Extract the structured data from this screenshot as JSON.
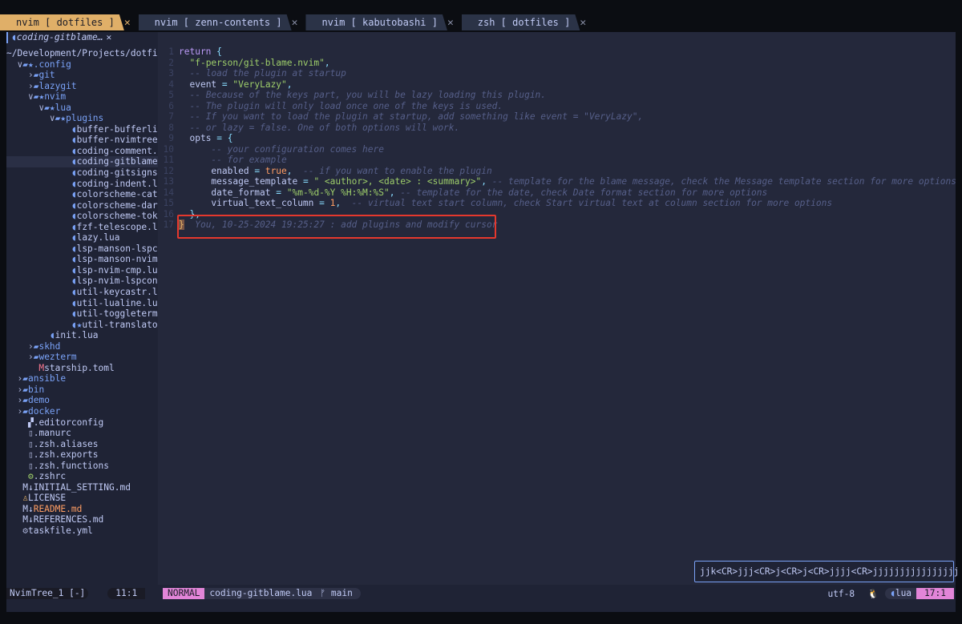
{
  "tabs": [
    {
      "label": "nvim [ dotfiles ]",
      "active": true
    },
    {
      "label": "nvim [ zenn-contents ]",
      "active": false
    },
    {
      "label": "nvim [ kabutobashi ]",
      "active": false
    },
    {
      "label": "zsh [ dotfiles ]",
      "active": false
    }
  ],
  "tab_close_glyph": "✕",
  "sidebar": {
    "header_file": "coding-gitblame…",
    "header_close": "✕",
    "root_path": "~/Development/Projects/dotfi",
    "rows": [
      {
        "indent": "  ",
        "arrow": "∨",
        "icon": "▰★",
        "label": ".config",
        "icolor": "c-blue",
        "lcolor": "c-blue"
      },
      {
        "indent": "    ",
        "arrow": "›",
        "icon": "▰",
        "label": "git",
        "icolor": "c-blue",
        "lcolor": "c-blue"
      },
      {
        "indent": "    ",
        "arrow": "›",
        "icon": "▰",
        "label": "lazygit",
        "icolor": "c-blue",
        "lcolor": "c-blue"
      },
      {
        "indent": "    ",
        "arrow": "∨",
        "icon": "▰★",
        "label": "nvim",
        "icolor": "c-blue",
        "lcolor": "c-blue"
      },
      {
        "indent": "      ",
        "arrow": "∨",
        "icon": "▰★",
        "label": "lua",
        "icolor": "c-blue",
        "lcolor": "c-blue"
      },
      {
        "indent": "        ",
        "arrow": "∨",
        "icon": "▰★",
        "label": "plugins",
        "icolor": "c-blue",
        "lcolor": "c-blue"
      },
      {
        "indent": "            ",
        "arrow": "",
        "icon": "◖",
        "label": "buffer-bufferlin",
        "icolor": "c-blue",
        "lcolor": "c-white"
      },
      {
        "indent": "            ",
        "arrow": "",
        "icon": "◖",
        "label": "buffer-nvimtree.",
        "icolor": "c-blue",
        "lcolor": "c-white"
      },
      {
        "indent": "            ",
        "arrow": "",
        "icon": "◖",
        "label": "coding-comment.l",
        "icolor": "c-blue",
        "lcolor": "c-white"
      },
      {
        "indent": "            ",
        "arrow": "",
        "icon": "◖",
        "label": "coding-gitblame.",
        "icolor": "c-blue",
        "lcolor": "c-white",
        "selected": true
      },
      {
        "indent": "            ",
        "arrow": "",
        "icon": "◖",
        "label": "coding-gitsigns.",
        "icolor": "c-blue",
        "lcolor": "c-white"
      },
      {
        "indent": "            ",
        "arrow": "",
        "icon": "◖",
        "label": "coding-indent.lu",
        "icolor": "c-blue",
        "lcolor": "c-white"
      },
      {
        "indent": "            ",
        "arrow": "",
        "icon": "◖",
        "label": "colorscheme-catp",
        "icolor": "c-blue",
        "lcolor": "c-white"
      },
      {
        "indent": "            ",
        "arrow": "",
        "icon": "◖",
        "label": "colorscheme-darc",
        "icolor": "c-blue",
        "lcolor": "c-white"
      },
      {
        "indent": "            ",
        "arrow": "",
        "icon": "◖",
        "label": "colorscheme-toky",
        "icolor": "c-blue",
        "lcolor": "c-white"
      },
      {
        "indent": "            ",
        "arrow": "",
        "icon": "◖",
        "label": "fzf-telescope.lu",
        "icolor": "c-blue",
        "lcolor": "c-white"
      },
      {
        "indent": "            ",
        "arrow": "",
        "icon": "◖",
        "label": "lazy.lua",
        "icolor": "c-blue",
        "lcolor": "c-white"
      },
      {
        "indent": "            ",
        "arrow": "",
        "icon": "◖",
        "label": "lsp-manson-lspco",
        "icolor": "c-blue",
        "lcolor": "c-white"
      },
      {
        "indent": "            ",
        "arrow": "",
        "icon": "◖",
        "label": "lsp-manson-nvim.",
        "icolor": "c-blue",
        "lcolor": "c-white"
      },
      {
        "indent": "            ",
        "arrow": "",
        "icon": "◖",
        "label": "lsp-nvim-cmp.lua",
        "icolor": "c-blue",
        "lcolor": "c-white"
      },
      {
        "indent": "            ",
        "arrow": "",
        "icon": "◖",
        "label": "lsp-nvim-lspconf",
        "icolor": "c-blue",
        "lcolor": "c-white"
      },
      {
        "indent": "            ",
        "arrow": "",
        "icon": "◖",
        "label": "util-keycastr.lu",
        "icolor": "c-blue",
        "lcolor": "c-white"
      },
      {
        "indent": "            ",
        "arrow": "",
        "icon": "◖",
        "label": "util-lualine.lua",
        "icolor": "c-blue",
        "lcolor": "c-white"
      },
      {
        "indent": "            ",
        "arrow": "",
        "icon": "◖",
        "label": "util-toggleterm.",
        "icolor": "c-blue",
        "lcolor": "c-white"
      },
      {
        "indent": "            ",
        "arrow": "",
        "icon": "◖★",
        "label": "util-translato",
        "icolor": "c-blue",
        "lcolor": "c-white"
      },
      {
        "indent": "        ",
        "arrow": "",
        "icon": "◖",
        "label": "init.lua",
        "icolor": "c-blue",
        "lcolor": "c-white"
      },
      {
        "indent": "    ",
        "arrow": "›",
        "icon": "▰",
        "label": "skhd",
        "icolor": "c-blue",
        "lcolor": "c-blue"
      },
      {
        "indent": "    ",
        "arrow": "›",
        "icon": "▰",
        "label": "wezterm",
        "icolor": "c-blue",
        "lcolor": "c-blue"
      },
      {
        "indent": "      ",
        "arrow": "",
        "icon": "M",
        "label": "starship.toml",
        "icolor": "c-red",
        "lcolor": "c-white"
      },
      {
        "indent": "  ",
        "arrow": "›",
        "icon": "▰",
        "label": "ansible",
        "icolor": "c-blue",
        "lcolor": "c-blue"
      },
      {
        "indent": "  ",
        "arrow": "›",
        "icon": "▰",
        "label": "bin",
        "icolor": "c-blue",
        "lcolor": "c-blue"
      },
      {
        "indent": "  ",
        "arrow": "›",
        "icon": "▰",
        "label": "demo",
        "icolor": "c-blue",
        "lcolor": "c-blue"
      },
      {
        "indent": "  ",
        "arrow": "›",
        "icon": "▰",
        "label": "docker",
        "icolor": "c-blue",
        "lcolor": "c-blue"
      },
      {
        "indent": "    ",
        "arrow": "",
        "icon": "▞",
        "label": ".editorconfig",
        "icolor": "c-white",
        "lcolor": "c-white"
      },
      {
        "indent": "    ",
        "arrow": "",
        "icon": "▯",
        "label": ".manurc",
        "icolor": "c-dim",
        "lcolor": "c-white"
      },
      {
        "indent": "    ",
        "arrow": "",
        "icon": "▯",
        "label": ".zsh.aliases",
        "icolor": "c-dim",
        "lcolor": "c-white"
      },
      {
        "indent": "    ",
        "arrow": "",
        "icon": "▯",
        "label": ".zsh.exports",
        "icolor": "c-dim",
        "lcolor": "c-white"
      },
      {
        "indent": "    ",
        "arrow": "",
        "icon": "▯",
        "label": ".zsh.functions",
        "icolor": "c-dim",
        "lcolor": "c-white"
      },
      {
        "indent": "    ",
        "arrow": "",
        "icon": "⚙",
        "label": ".zshrc",
        "icolor": "c-green",
        "lcolor": "c-white"
      },
      {
        "indent": "   ",
        "arrow": "",
        "icon": "M↓",
        "label": "INITIAL_SETTING.md",
        "icolor": "c-white",
        "lcolor": "c-white"
      },
      {
        "indent": "   ",
        "arrow": "",
        "icon": "♙",
        "label": "LICENSE",
        "icolor": "c-yellow",
        "lcolor": "c-white"
      },
      {
        "indent": "   ",
        "arrow": "",
        "icon": "M↓",
        "label": "README.md",
        "icolor": "c-white",
        "lcolor": "c-orange"
      },
      {
        "indent": "   ",
        "arrow": "",
        "icon": "M↓",
        "label": "REFERENCES.md",
        "icolor": "c-white",
        "lcolor": "c-white"
      },
      {
        "indent": "   ",
        "arrow": "",
        "icon": "⚙",
        "label": "taskfile.yml",
        "icolor": "c-dim",
        "lcolor": "c-white"
      }
    ]
  },
  "editor": {
    "lines": [
      {
        "n": "1",
        "html": "<span class='kw'>return</span> <span class='op'>{</span>"
      },
      {
        "n": "2",
        "html": "  <span class='str'>\"f-person/git-blame.nvim\"</span><span class='op'>,</span>"
      },
      {
        "n": "3",
        "html": "  <span class='cm'>-- load the plugin at startup</span>"
      },
      {
        "n": "4",
        "html": "  <span class='key'>event</span> <span class='op'>=</span> <span class='str'>\"VeryLazy\"</span><span class='op'>,</span>"
      },
      {
        "n": "5",
        "html": "  <span class='cm'>-- Because of the keys part, you will be lazy loading this plugin.</span>"
      },
      {
        "n": "6",
        "html": "  <span class='cm'>-- The plugin will only load once one of the keys is used.</span>"
      },
      {
        "n": "7",
        "html": "  <span class='cm'>-- If you want to load the plugin at startup, add something like event = \"VeryLazy\",</span>"
      },
      {
        "n": "8",
        "html": "  <span class='cm'>-- or lazy = false. One of both options will work.</span>"
      },
      {
        "n": "9",
        "html": "  <span class='key'>opts</span> <span class='op'>=</span> <span class='op'>{</span>"
      },
      {
        "n": "10",
        "html": "      <span class='cm'>-- your configuration comes here</span>"
      },
      {
        "n": "11",
        "html": "      <span class='cm'>-- for example</span>"
      },
      {
        "n": "12",
        "html": "      <span class='key'>enabled</span> <span class='op'>=</span> <span class='num'>true</span><span class='op'>,</span>  <span class='cm'>-- if you want to enable the plugin</span>"
      },
      {
        "n": "13",
        "html": "      <span class='key'>message_template</span> <span class='op'>=</span> <span class='str'>\" &lt;author&gt;, &lt;date&gt; : &lt;summary&gt;\"</span><span class='op'>,</span> <span class='cm'>-- template for the blame message, check the Message template section for more options</span>"
      },
      {
        "n": "14",
        "html": "      <span class='key'>date_format</span> <span class='op'>=</span> <span class='str'>\"%m-%d-%Y %H:%M:%S\"</span><span class='op'>,</span> <span class='cm'>-- template for the date, check Date format section for more options</span>"
      },
      {
        "n": "15",
        "html": "      <span class='key'>virtual_text_column</span> <span class='op'>=</span> <span class='num'>1</span><span class='op'>,</span>  <span class='cm'>-- virtual text start column, check Start virtual text at column section for more options</span>"
      },
      {
        "n": "16",
        "html": "  <span class='op'>},</span>"
      },
      {
        "n": "17",
        "html": "<span class='cursor-block'>}</span>  <span class='blame'>You, 10-25-2024 19:25:27 : add plugins and modify cursor</span>"
      }
    ]
  },
  "keystroke": "jjk<CR>jjj<CR>j<CR>j<CR>jjjj<CR>jjjjjjjjjjjjjjjj",
  "statusline": {
    "tree_name": "NvimTree_1 [-]",
    "tree_pos": "11:1",
    "mode": "NORMAL",
    "file": "coding-gitblame.lua",
    "branch_icon": "ᚠ",
    "branch": "main",
    "encoding": "utf-8",
    "os_icon": "🐧",
    "filetype_icon": "◖",
    "filetype": "lua",
    "cursor_pos": "17:1"
  }
}
